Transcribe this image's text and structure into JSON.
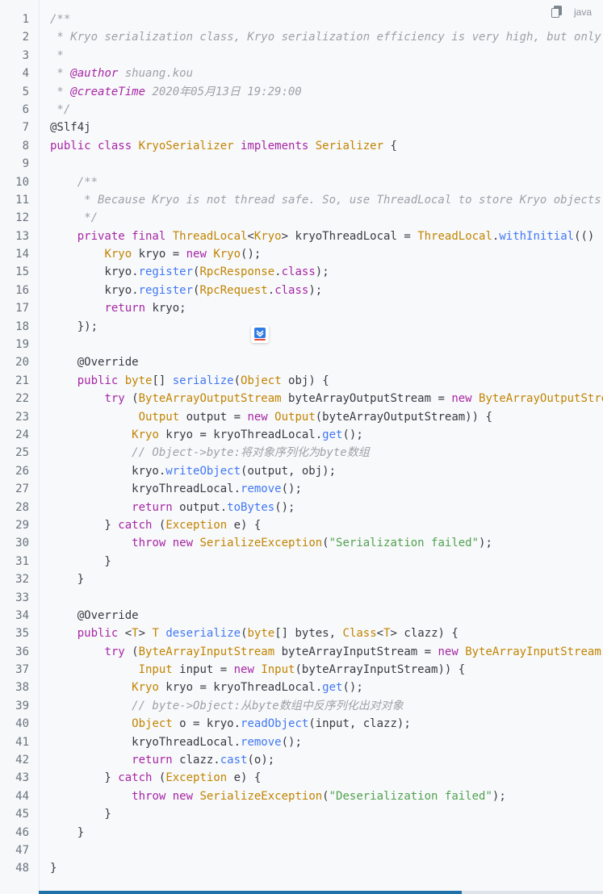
{
  "header": {
    "language_label": "java",
    "copy_icon": "copy-icon"
  },
  "floating_button": {
    "icon": "download-arrow-icon"
  },
  "code_lines": [
    {
      "n": "1",
      "tokens": [
        {
          "c": "comment",
          "t": "/**"
        }
      ]
    },
    {
      "n": "2",
      "tokens": [
        {
          "c": "comment",
          "t": " * Kryo serialization class, Kryo serialization efficiency is very high, but only compatible with Java language"
        }
      ]
    },
    {
      "n": "3",
      "tokens": [
        {
          "c": "comment",
          "t": " *"
        }
      ]
    },
    {
      "n": "4",
      "tokens": [
        {
          "c": "comment",
          "t": " * "
        },
        {
          "c": "ann",
          "t": "@author"
        },
        {
          "c": "comment",
          "t": " shuang.kou"
        }
      ]
    },
    {
      "n": "5",
      "tokens": [
        {
          "c": "comment",
          "t": " * "
        },
        {
          "c": "ann",
          "t": "@createTime"
        },
        {
          "c": "comment",
          "t": " 2020年05月13日 19:29:00"
        }
      ]
    },
    {
      "n": "6",
      "tokens": [
        {
          "c": "comment",
          "t": " */"
        }
      ]
    },
    {
      "n": "7",
      "tokens": [
        {
          "c": "plain",
          "t": "@Slf4j"
        }
      ]
    },
    {
      "n": "8",
      "tokens": [
        {
          "c": "kw",
          "t": "public class "
        },
        {
          "c": "type",
          "t": "KryoSerializer"
        },
        {
          "c": "kw",
          "t": " implements "
        },
        {
          "c": "type",
          "t": "Serializer"
        },
        {
          "c": "plain",
          "t": " {"
        }
      ]
    },
    {
      "n": "9",
      "tokens": []
    },
    {
      "n": "10",
      "tokens": [
        {
          "c": "comment",
          "t": "    /**"
        }
      ]
    },
    {
      "n": "11",
      "tokens": [
        {
          "c": "comment",
          "t": "     * Because Kryo is not thread safe. So, use ThreadLocal to store Kryo objects"
        }
      ]
    },
    {
      "n": "12",
      "tokens": [
        {
          "c": "comment",
          "t": "     */"
        }
      ]
    },
    {
      "n": "13",
      "tokens": [
        {
          "c": "plain",
          "t": "    "
        },
        {
          "c": "kw",
          "t": "private final "
        },
        {
          "c": "type",
          "t": "ThreadLocal"
        },
        {
          "c": "plain",
          "t": "<"
        },
        {
          "c": "type",
          "t": "Kryo"
        },
        {
          "c": "plain",
          "t": "> kryoThreadLocal = "
        },
        {
          "c": "type",
          "t": "ThreadLocal"
        },
        {
          "c": "plain",
          "t": "."
        },
        {
          "c": "fn",
          "t": "withInitial"
        },
        {
          "c": "plain",
          "t": "(() -> {"
        }
      ]
    },
    {
      "n": "14",
      "tokens": [
        {
          "c": "plain",
          "t": "        "
        },
        {
          "c": "type",
          "t": "Kryo"
        },
        {
          "c": "plain",
          "t": " kryo = "
        },
        {
          "c": "kw",
          "t": "new "
        },
        {
          "c": "type",
          "t": "Kryo"
        },
        {
          "c": "plain",
          "t": "();"
        }
      ]
    },
    {
      "n": "15",
      "tokens": [
        {
          "c": "plain",
          "t": "        kryo."
        },
        {
          "c": "fn",
          "t": "register"
        },
        {
          "c": "plain",
          "t": "("
        },
        {
          "c": "type",
          "t": "RpcResponse"
        },
        {
          "c": "plain",
          "t": "."
        },
        {
          "c": "kw",
          "t": "class"
        },
        {
          "c": "plain",
          "t": ");"
        }
      ]
    },
    {
      "n": "16",
      "tokens": [
        {
          "c": "plain",
          "t": "        kryo."
        },
        {
          "c": "fn",
          "t": "register"
        },
        {
          "c": "plain",
          "t": "("
        },
        {
          "c": "type",
          "t": "RpcRequest"
        },
        {
          "c": "plain",
          "t": "."
        },
        {
          "c": "kw",
          "t": "class"
        },
        {
          "c": "plain",
          "t": ");"
        }
      ]
    },
    {
      "n": "17",
      "tokens": [
        {
          "c": "plain",
          "t": "        "
        },
        {
          "c": "kw",
          "t": "return"
        },
        {
          "c": "plain",
          "t": " kryo;"
        }
      ]
    },
    {
      "n": "18",
      "tokens": [
        {
          "c": "plain",
          "t": "    });"
        }
      ]
    },
    {
      "n": "19",
      "tokens": []
    },
    {
      "n": "20",
      "tokens": [
        {
          "c": "plain",
          "t": "    @Override"
        }
      ]
    },
    {
      "n": "21",
      "tokens": [
        {
          "c": "plain",
          "t": "    "
        },
        {
          "c": "kw",
          "t": "public "
        },
        {
          "c": "type",
          "t": "byte"
        },
        {
          "c": "plain",
          "t": "[] "
        },
        {
          "c": "fn",
          "t": "serialize"
        },
        {
          "c": "plain",
          "t": "("
        },
        {
          "c": "type",
          "t": "Object"
        },
        {
          "c": "plain",
          "t": " obj) {"
        }
      ]
    },
    {
      "n": "22",
      "tokens": [
        {
          "c": "plain",
          "t": "        "
        },
        {
          "c": "kw",
          "t": "try"
        },
        {
          "c": "plain",
          "t": " ("
        },
        {
          "c": "type",
          "t": "ByteArrayOutputStream"
        },
        {
          "c": "plain",
          "t": " byteArrayOutputStream = "
        },
        {
          "c": "kw",
          "t": "new "
        },
        {
          "c": "type",
          "t": "ByteArrayOutputStream"
        },
        {
          "c": "plain",
          "t": "();"
        }
      ]
    },
    {
      "n": "23",
      "tokens": [
        {
          "c": "plain",
          "t": "             "
        },
        {
          "c": "type",
          "t": "Output"
        },
        {
          "c": "plain",
          "t": " output = "
        },
        {
          "c": "kw",
          "t": "new "
        },
        {
          "c": "type",
          "t": "Output"
        },
        {
          "c": "plain",
          "t": "(byteArrayOutputStream)) {"
        }
      ]
    },
    {
      "n": "24",
      "tokens": [
        {
          "c": "plain",
          "t": "            "
        },
        {
          "c": "type",
          "t": "Kryo"
        },
        {
          "c": "plain",
          "t": " kryo = kryoThreadLocal."
        },
        {
          "c": "fn",
          "t": "get"
        },
        {
          "c": "plain",
          "t": "();"
        }
      ]
    },
    {
      "n": "25",
      "tokens": [
        {
          "c": "comment",
          "t": "            // Object->byte:将对象序列化为byte数组"
        }
      ]
    },
    {
      "n": "26",
      "tokens": [
        {
          "c": "plain",
          "t": "            kryo."
        },
        {
          "c": "fn",
          "t": "writeObject"
        },
        {
          "c": "plain",
          "t": "(output, obj);"
        }
      ]
    },
    {
      "n": "27",
      "tokens": [
        {
          "c": "plain",
          "t": "            kryoThreadLocal."
        },
        {
          "c": "fn",
          "t": "remove"
        },
        {
          "c": "plain",
          "t": "();"
        }
      ]
    },
    {
      "n": "28",
      "tokens": [
        {
          "c": "plain",
          "t": "            "
        },
        {
          "c": "kw",
          "t": "return"
        },
        {
          "c": "plain",
          "t": " output."
        },
        {
          "c": "fn",
          "t": "toBytes"
        },
        {
          "c": "plain",
          "t": "();"
        }
      ]
    },
    {
      "n": "29",
      "tokens": [
        {
          "c": "plain",
          "t": "        } "
        },
        {
          "c": "kw",
          "t": "catch"
        },
        {
          "c": "plain",
          "t": " ("
        },
        {
          "c": "type",
          "t": "Exception"
        },
        {
          "c": "plain",
          "t": " e) {"
        }
      ]
    },
    {
      "n": "30",
      "tokens": [
        {
          "c": "plain",
          "t": "            "
        },
        {
          "c": "kw",
          "t": "throw new "
        },
        {
          "c": "type",
          "t": "SerializeException"
        },
        {
          "c": "plain",
          "t": "("
        },
        {
          "c": "str",
          "t": "\"Serialization failed\""
        },
        {
          "c": "plain",
          "t": ");"
        }
      ]
    },
    {
      "n": "31",
      "tokens": [
        {
          "c": "plain",
          "t": "        }"
        }
      ]
    },
    {
      "n": "32",
      "tokens": [
        {
          "c": "plain",
          "t": "    }"
        }
      ]
    },
    {
      "n": "33",
      "tokens": []
    },
    {
      "n": "34",
      "tokens": [
        {
          "c": "plain",
          "t": "    @Override"
        }
      ]
    },
    {
      "n": "35",
      "tokens": [
        {
          "c": "plain",
          "t": "    "
        },
        {
          "c": "kw",
          "t": "public "
        },
        {
          "c": "plain",
          "t": "<"
        },
        {
          "c": "type",
          "t": "T"
        },
        {
          "c": "plain",
          "t": "> "
        },
        {
          "c": "type",
          "t": "T"
        },
        {
          "c": "plain",
          "t": " "
        },
        {
          "c": "fn",
          "t": "deserialize"
        },
        {
          "c": "plain",
          "t": "("
        },
        {
          "c": "type",
          "t": "byte"
        },
        {
          "c": "plain",
          "t": "[] bytes, "
        },
        {
          "c": "type",
          "t": "Class"
        },
        {
          "c": "plain",
          "t": "<"
        },
        {
          "c": "type",
          "t": "T"
        },
        {
          "c": "plain",
          "t": "> clazz) {"
        }
      ]
    },
    {
      "n": "36",
      "tokens": [
        {
          "c": "plain",
          "t": "        "
        },
        {
          "c": "kw",
          "t": "try"
        },
        {
          "c": "plain",
          "t": " ("
        },
        {
          "c": "type",
          "t": "ByteArrayInputStream"
        },
        {
          "c": "plain",
          "t": " byteArrayInputStream = "
        },
        {
          "c": "kw",
          "t": "new "
        },
        {
          "c": "type",
          "t": "ByteArrayInputStream"
        },
        {
          "c": "plain",
          "t": "(bytes);"
        }
      ]
    },
    {
      "n": "37",
      "tokens": [
        {
          "c": "plain",
          "t": "             "
        },
        {
          "c": "type",
          "t": "Input"
        },
        {
          "c": "plain",
          "t": " input = "
        },
        {
          "c": "kw",
          "t": "new "
        },
        {
          "c": "type",
          "t": "Input"
        },
        {
          "c": "plain",
          "t": "(byteArrayInputStream)) {"
        }
      ]
    },
    {
      "n": "38",
      "tokens": [
        {
          "c": "plain",
          "t": "            "
        },
        {
          "c": "type",
          "t": "Kryo"
        },
        {
          "c": "plain",
          "t": " kryo = kryoThreadLocal."
        },
        {
          "c": "fn",
          "t": "get"
        },
        {
          "c": "plain",
          "t": "();"
        }
      ]
    },
    {
      "n": "39",
      "tokens": [
        {
          "c": "comment",
          "t": "            // byte->Object:从byte数组中反序列化出对对象"
        }
      ]
    },
    {
      "n": "40",
      "tokens": [
        {
          "c": "plain",
          "t": "            "
        },
        {
          "c": "type",
          "t": "Object"
        },
        {
          "c": "plain",
          "t": " o = kryo."
        },
        {
          "c": "fn",
          "t": "readObject"
        },
        {
          "c": "plain",
          "t": "(input, clazz);"
        }
      ]
    },
    {
      "n": "41",
      "tokens": [
        {
          "c": "plain",
          "t": "            kryoThreadLocal."
        },
        {
          "c": "fn",
          "t": "remove"
        },
        {
          "c": "plain",
          "t": "();"
        }
      ]
    },
    {
      "n": "42",
      "tokens": [
        {
          "c": "plain",
          "t": "            "
        },
        {
          "c": "kw",
          "t": "return"
        },
        {
          "c": "plain",
          "t": " clazz."
        },
        {
          "c": "fn",
          "t": "cast"
        },
        {
          "c": "plain",
          "t": "(o);"
        }
      ]
    },
    {
      "n": "43",
      "tokens": [
        {
          "c": "plain",
          "t": "        } "
        },
        {
          "c": "kw",
          "t": "catch"
        },
        {
          "c": "plain",
          "t": " ("
        },
        {
          "c": "type",
          "t": "Exception"
        },
        {
          "c": "plain",
          "t": " e) {"
        }
      ]
    },
    {
      "n": "44",
      "tokens": [
        {
          "c": "plain",
          "t": "            "
        },
        {
          "c": "kw",
          "t": "throw new "
        },
        {
          "c": "type",
          "t": "SerializeException"
        },
        {
          "c": "plain",
          "t": "("
        },
        {
          "c": "str",
          "t": "\"Deserialization failed\""
        },
        {
          "c": "plain",
          "t": ");"
        }
      ]
    },
    {
      "n": "45",
      "tokens": [
        {
          "c": "plain",
          "t": "        }"
        }
      ]
    },
    {
      "n": "46",
      "tokens": [
        {
          "c": "plain",
          "t": "    }"
        }
      ]
    },
    {
      "n": "47",
      "tokens": []
    },
    {
      "n": "48",
      "tokens": [
        {
          "c": "plain",
          "t": "}"
        }
      ]
    }
  ],
  "scrollbar": {
    "horizontal_position_fraction": 0.0,
    "visible_fraction": 0.75
  }
}
